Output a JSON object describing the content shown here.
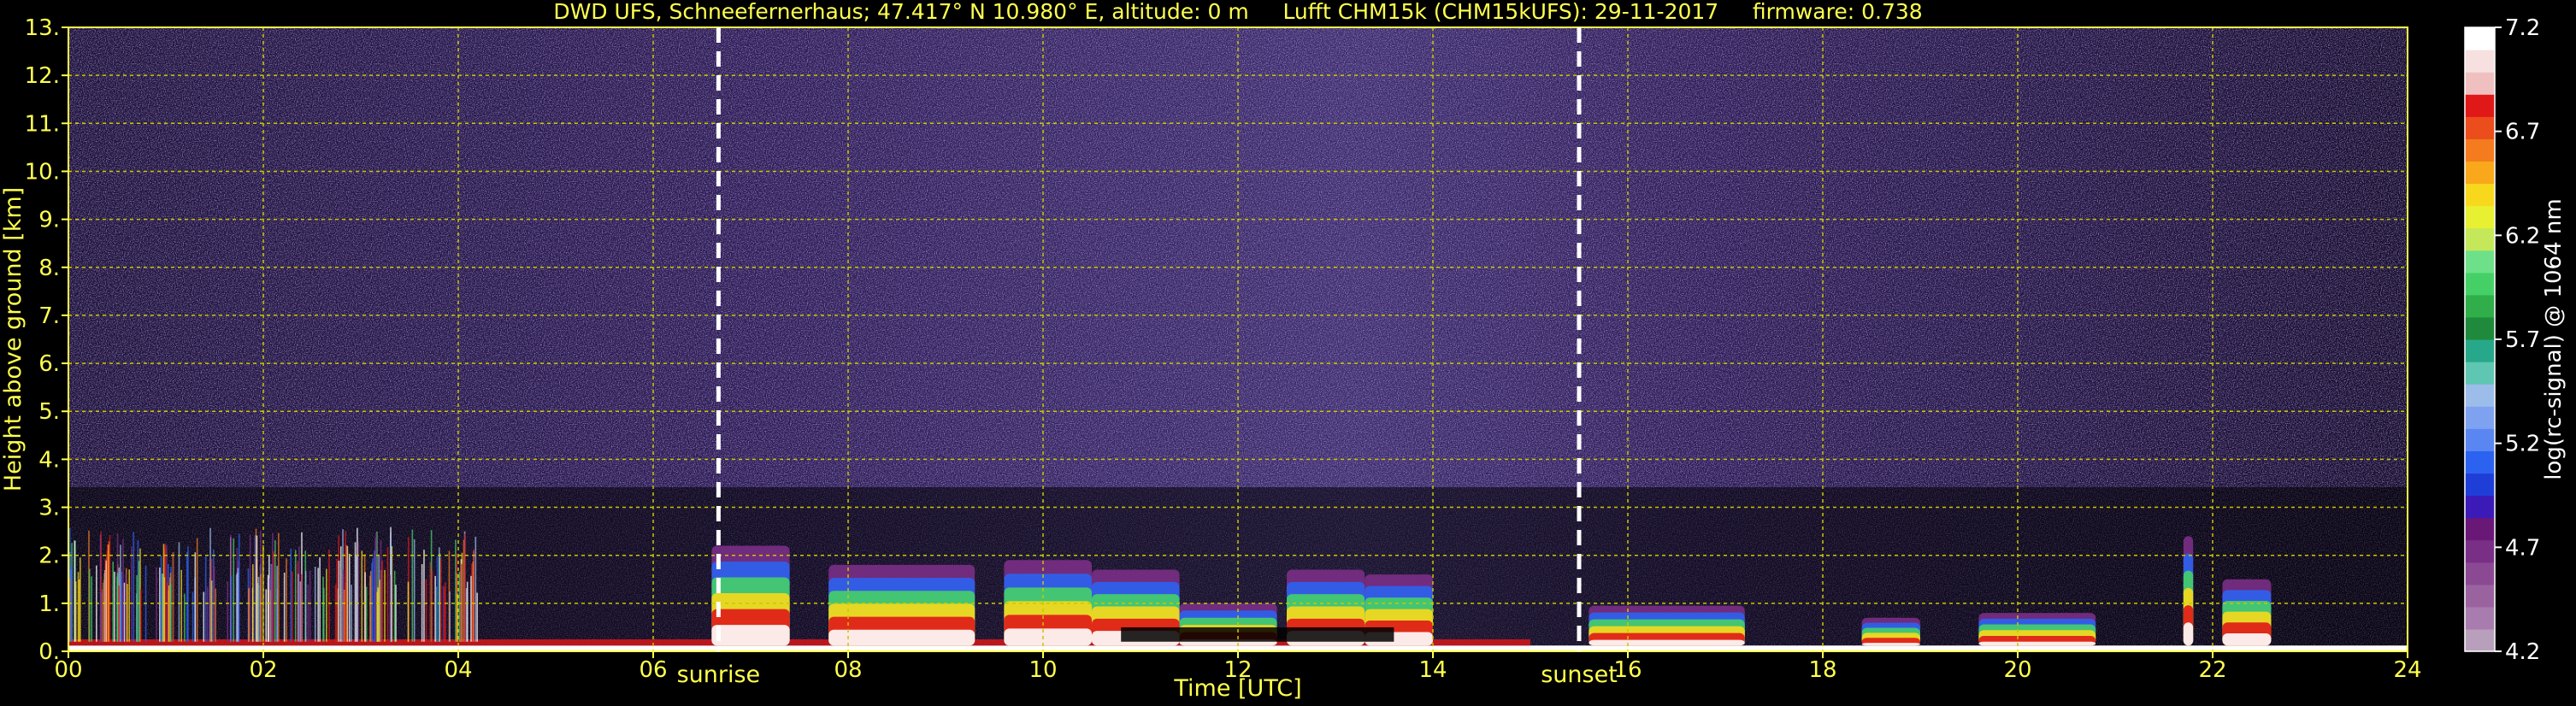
{
  "chart_data": {
    "type": "heatmap",
    "title": "DWD UFS, Schneefernerhaus; 47.417° N 10.980° E, altitude: 0 m     Lufft CHM15k (CHM15kUFS): 29-11-2017     firmware: 0.738",
    "xlabel": "Time [UTC]",
    "ylabel": "Height above ground [km]",
    "xlim": [
      0,
      24
    ],
    "ylim": [
      0,
      13
    ],
    "x_ticks": [
      "00",
      "02",
      "04",
      "06",
      "08",
      "10",
      "12",
      "14",
      "16",
      "18",
      "20",
      "22",
      "24"
    ],
    "y_ticks": [
      "0.",
      "1.",
      "2.",
      "3.",
      "4.",
      "5.",
      "6.",
      "7.",
      "8.",
      "9.",
      "10.",
      "11.",
      "12.",
      "13."
    ],
    "grid": true,
    "markers": [
      {
        "label": "sunrise",
        "x": 6.67
      },
      {
        "label": "sunset",
        "x": 15.5
      }
    ],
    "colorbar": {
      "label": "log(rc-signal) @ 1064 nm",
      "range": [
        4.2,
        7.2
      ],
      "ticks": [
        "7.2",
        "6.7",
        "6.2",
        "5.7",
        "5.2",
        "4.7",
        "4.2"
      ],
      "colors": [
        "#b8a0bc",
        "#a87cae",
        "#9a63a0",
        "#8a4992",
        "#7a2f86",
        "#6a1878",
        "#3b1ab8",
        "#1f3ed8",
        "#2c62f0",
        "#5a86f2",
        "#7ea2ef",
        "#9cbcea",
        "#5ec6b2",
        "#28a88a",
        "#1f8a3c",
        "#2fae4a",
        "#45d067",
        "#6fe08a",
        "#c4e85a",
        "#e8f032",
        "#f8d81c",
        "#f8a81a",
        "#f47c1e",
        "#ec4d1c",
        "#e01818",
        "#f0c0c0",
        "#f6e0e0",
        "#ffffff"
      ]
    },
    "colors": {
      "axis_text": "#ffff4d",
      "grid": "#c8c800",
      "marker": "#ffffff"
    }
  }
}
